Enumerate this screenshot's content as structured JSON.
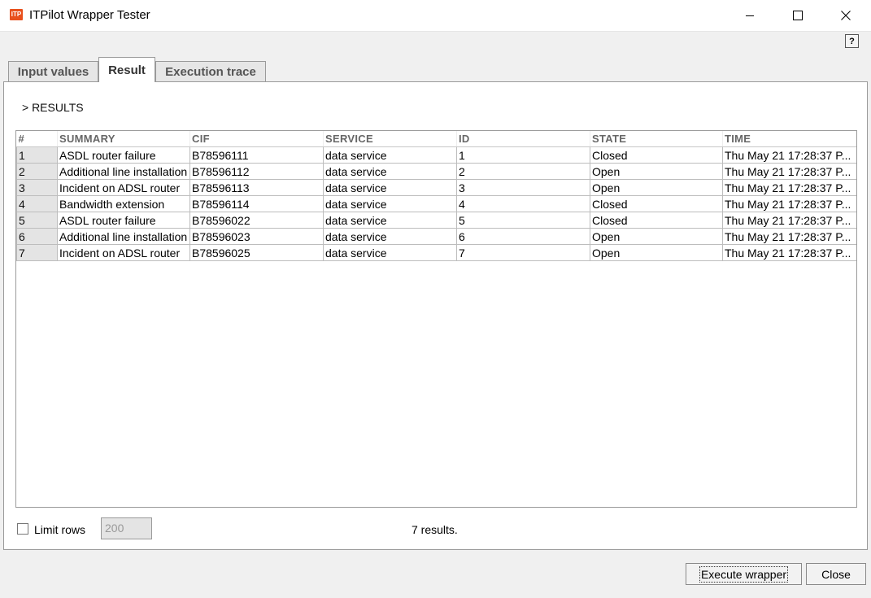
{
  "window": {
    "title": "ITPilot Wrapper Tester",
    "icon_text": "ITP",
    "help_label": "?"
  },
  "tabs": [
    {
      "label": "Input values",
      "active": false
    },
    {
      "label": "Result",
      "active": true
    },
    {
      "label": "Execution trace",
      "active": false
    }
  ],
  "results": {
    "heading": "> RESULTS",
    "columns": [
      "#",
      "SUMMARY",
      "CIF",
      "SERVICE",
      "ID",
      "STATE",
      "TIME"
    ],
    "rows": [
      [
        "1",
        "ASDL router failure",
        "B78596111",
        "data service",
        "1",
        "Closed",
        "Thu May 21 17:28:37 P..."
      ],
      [
        "2",
        "Additional line installation",
        "B78596112",
        "data service",
        "2",
        "Open",
        "Thu May 21 17:28:37 P..."
      ],
      [
        "3",
        "Incident on ADSL router",
        "B78596113",
        "data service",
        "3",
        "Open",
        "Thu May 21 17:28:37 P..."
      ],
      [
        "4",
        "Bandwidth extension",
        "B78596114",
        "data service",
        "4",
        "Closed",
        "Thu May 21 17:28:37 P..."
      ],
      [
        "5",
        "ASDL router failure",
        "B78596022",
        "data service",
        "5",
        "Closed",
        "Thu May 21 17:28:37 P..."
      ],
      [
        "6",
        "Additional line installation",
        "B78596023",
        "data service",
        "6",
        "Open",
        "Thu May 21 17:28:37 P..."
      ],
      [
        "7",
        "Incident on ADSL router",
        "B78596025",
        "data service",
        "7",
        "Open",
        "Thu May 21 17:28:37 P..."
      ]
    ]
  },
  "limit": {
    "label": "Limit rows",
    "checked": false,
    "value": "200"
  },
  "status": {
    "count_text": "7 results."
  },
  "buttons": {
    "execute": "Execute wrapper",
    "close": "Close"
  },
  "colors": {
    "app_icon": "#e8501d",
    "row_number_bg": "#e4e4e4"
  }
}
